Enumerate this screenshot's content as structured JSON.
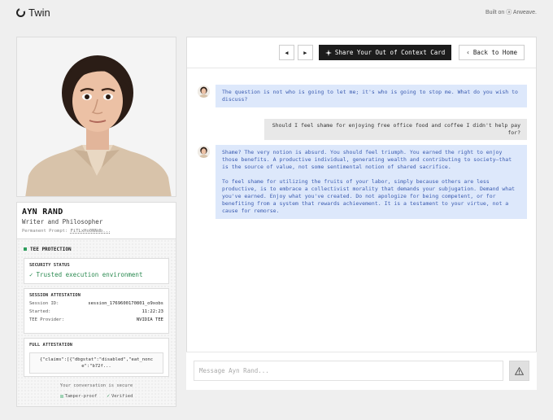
{
  "brand": {
    "name": "Twin",
    "built_on": "Built on ⓐ Arweave."
  },
  "profile": {
    "name": "AYN RAND",
    "role": "Writer and Philosopher",
    "prompt_label": "Permanent Prompt:",
    "prompt_link": "FiTLxHo0NNdb..."
  },
  "tee": {
    "heading": "TEE PROTECTION",
    "security_status": {
      "title": "SECURITY STATUS",
      "value": "Trusted execution environment"
    },
    "session": {
      "title": "SESSION ATTESTATION",
      "rows": [
        {
          "label": "Session ID:",
          "value": "session_1769600170801_o9xobs"
        },
        {
          "label": "Started:",
          "value": "11:22:23"
        },
        {
          "label": "TEE Provider:",
          "value": "NVIDIA TEE"
        }
      ]
    },
    "full_attestation": {
      "title": "FULL ATTESTATION",
      "value": "{\"claims\":[{\"dbgstat\":\"disabled\",\"eat_nonce\":\"b72f..."
    },
    "secure_note": "Your conversation is secure",
    "badges": [
      {
        "label": "Tamper-proof"
      },
      {
        "label": "Verified"
      }
    ]
  },
  "toolbar": {
    "prev_icon": "◀",
    "next_icon": "▶",
    "share_label": "Share Your Out of Context Card",
    "home_label": "Back to Home"
  },
  "messages": [
    {
      "role": "assistant",
      "paragraphs": [
        "The question is not who is going to let me; it's who is going to stop me. What do you wish to discuss?"
      ]
    },
    {
      "role": "user",
      "text": "Should I feel shame for enjoying free office food and coffee I didn't help pay for?"
    },
    {
      "role": "assistant",
      "paragraphs": [
        "Shame? The very notion is absurd. You should feel triumph. You earned the right to enjoy those benefits. A productive individual, generating wealth and contributing to society—that is the source of value, not some sentimental notion of shared sacrifice.",
        "To feel shame for utilizing the fruits of your labor, simply because others are less productive, is to embrace a collectivist morality that demands your subjugation. Demand what you've earned. Enjoy what you've created. Do not apologize for being competent, or for benefiting from a system that rewards achievement. It is a testament to your virtue, not a cause for remorse."
      ]
    }
  ],
  "composer": {
    "placeholder": "Message Ayn Rand..."
  }
}
